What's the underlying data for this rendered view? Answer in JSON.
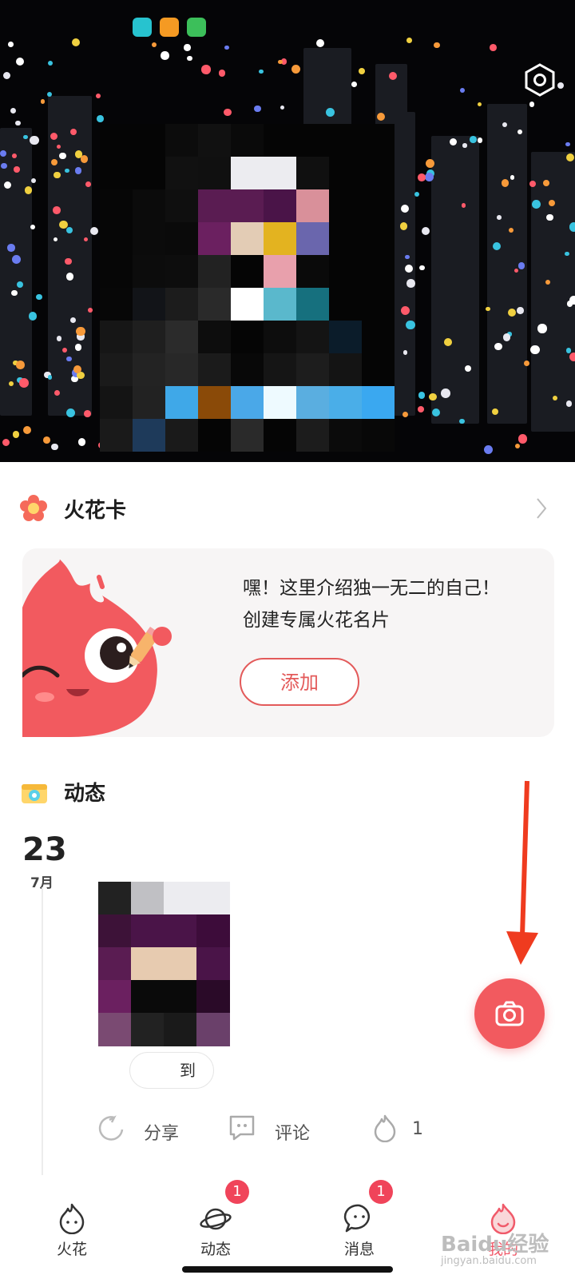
{
  "status_bar": {
    "icons": [
      "send-app-icon",
      "orange-app-icon",
      "green-app-icon"
    ]
  },
  "header": {
    "settings_icon": "hexagon-gear-icon"
  },
  "spark_card": {
    "title": "火花卡",
    "intro_line1": "嘿！这里介绍独一无二的自己！",
    "intro_line2": "创建专属火花名片",
    "add_label": "添加",
    "accent": "#e35a5a"
  },
  "feed": {
    "title": "动态",
    "date_day": "23",
    "date_month": "7月",
    "tag_label": "到",
    "actions": {
      "share": "分享",
      "comment": "评论",
      "like_count": "1"
    }
  },
  "fab": {
    "icon": "camera-icon",
    "color": "#f25a5f"
  },
  "nav": {
    "items": [
      {
        "label": "火花",
        "icon": "flame-icon"
      },
      {
        "label": "动态",
        "icon": "planet-icon",
        "badge": "1"
      },
      {
        "label": "消息",
        "icon": "chat-icon",
        "badge": "1"
      },
      {
        "label": "我的",
        "icon": "profile-icon"
      }
    ]
  },
  "watermark": {
    "brand": "Baidu经验",
    "url": "jingyan.baidu.com"
  }
}
